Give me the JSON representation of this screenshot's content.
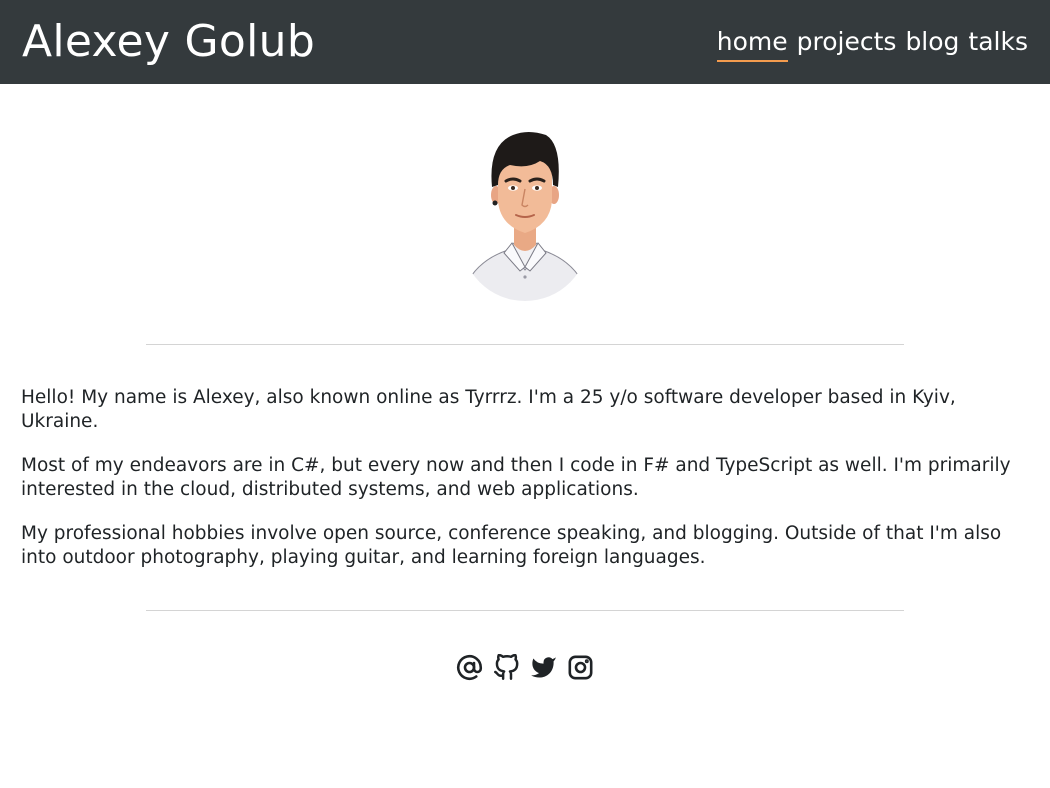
{
  "header": {
    "title": "Alexey Golub",
    "nav": [
      {
        "label": "home",
        "active": true
      },
      {
        "label": "projects",
        "active": false
      },
      {
        "label": "blog",
        "active": false
      },
      {
        "label": "talks",
        "active": false
      }
    ]
  },
  "colors": {
    "header_bg": "#343a3d",
    "accent_underline": "#f39b4e",
    "text": "#1f2326",
    "divider": "#d4d4d4"
  },
  "intro": {
    "paragraphs": [
      "Hello! My name is Alexey, also known online as Tyrrrz. I'm a 25 y/o software developer based in Kyiv, Ukraine.",
      "Most of my endeavors are in C#, but every now and then I code in F# and TypeScript as well. I'm primarily interested in the cloud, distributed systems, and web applications.",
      "My professional hobbies involve open source, conference speaking, and blogging. Outside of that I'm also into outdoor photography, playing guitar, and learning foreign languages."
    ]
  },
  "social": {
    "icons": [
      "at-sign-icon",
      "github-icon",
      "twitter-icon",
      "instagram-icon"
    ]
  }
}
